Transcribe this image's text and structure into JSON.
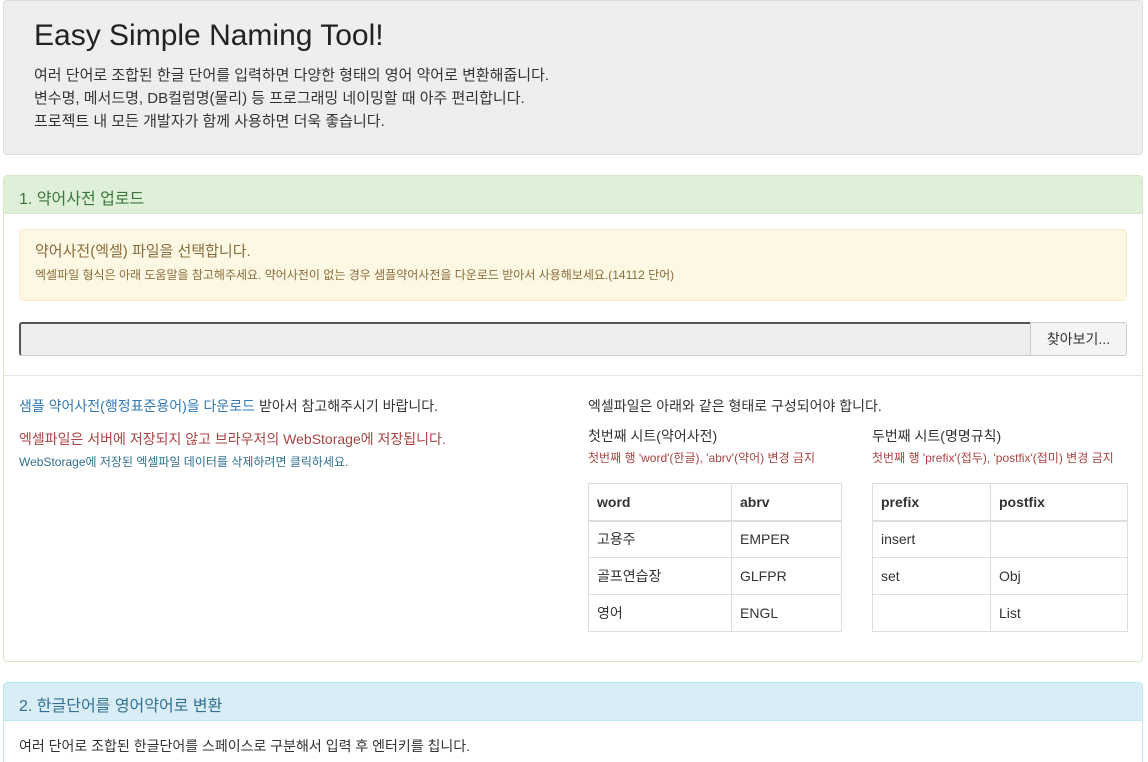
{
  "header": {
    "title": "Easy Simple Naming Tool!",
    "lines": [
      "여러 단어로 조합된 한글 단어를 입력하면 다양한 형태의 영어 약어로 변환해줍니다.",
      "변수명, 메서드명, DB컬럼명(물리) 등 프로그래밍 네이밍할 때 아주 편리합니다.",
      "프로젝트 내 모든 개발자가 함께 사용하면 더욱 좋습니다."
    ]
  },
  "section1": {
    "heading": "1. 약어사전 업로드",
    "alert_title": "약어사전(엑셀) 파일을 선택합니다.",
    "alert_desc": "엑셀파일 형식은 아래 도움말을 참고해주세요. 약어사전이 없는 경우 샘플약어사전을 다운로드 받아서 사용해보세요.(14112 단어)",
    "browse_label": "찾아보기...",
    "sample_link": "샘플 약어사전(행정표준용어)을 다운로드",
    "sample_suffix": " 받아서 참고해주시기 바랍니다.",
    "storage_note": "엑셀파일은 서버에 저장되지 않고 브라우저의 WebStorage에 저장됩니다.",
    "delete_link": "WebStorage에 저장된 엑셀파일 데이터를 삭제하려면 클릭하세요.",
    "format_title": "엑셀파일은 아래와 같은 형태로 구성되어야 합니다.",
    "sheet1": {
      "title": "첫번째 시트(약어사전)",
      "note": "첫번째 행 'word'(한글), 'abrv'(약어) 변경 금지",
      "headers": [
        "word",
        "abrv"
      ],
      "rows": [
        [
          "고용주",
          "EMPER"
        ],
        [
          "골프연습장",
          "GLFPR"
        ],
        [
          "영어",
          "ENGL"
        ]
      ]
    },
    "sheet2": {
      "title": "두번째 시트(명명규칙)",
      "note": "첫번째 행 'prefix'(접두), 'postfix'(접미) 변경 금지",
      "headers": [
        "prefix",
        "postfix"
      ],
      "rows": [
        [
          "insert",
          ""
        ],
        [
          "set",
          "Obj"
        ],
        [
          "",
          "List"
        ]
      ]
    }
  },
  "section2": {
    "heading": "2. 한글단어를 영어약어로 변환",
    "desc": "여러 단어로 조합된 한글단어를 스페이스로 구분해서 입력 후 엔터키를 칩니다."
  }
}
